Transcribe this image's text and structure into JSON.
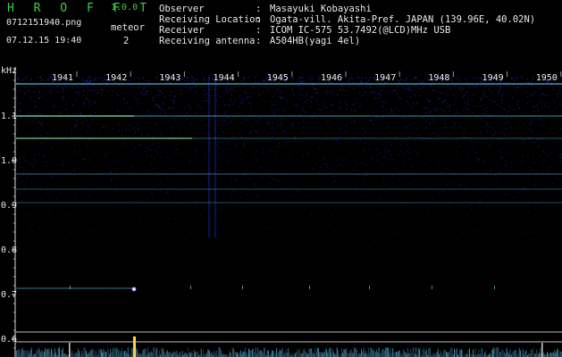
{
  "header": {
    "app_name": "H R O F F T",
    "app_version": "1.0.0",
    "file_name": "0712151940.png",
    "datetime": "07.12.15 19:40",
    "meteor_label": "meteor",
    "meteor_count": "2",
    "info": [
      {
        "label": "Observer",
        "value": "Masayuki Kobayashi"
      },
      {
        "label": "Receiving Location",
        "value": "Ogata-vill. Akita-Pref. JAPAN (139.96E, 40.02N)"
      },
      {
        "label": "Receiver",
        "value": "ICOM IC-575 53.7492(@LCD)MHz USB"
      },
      {
        "label": "Receiving antenna",
        "value": "A504HB(yagi 4el)"
      }
    ],
    "separator": ":"
  },
  "spectrogram": {
    "y_unit": "kHz",
    "y_ticks": [
      "1.1",
      "1.0",
      "0.9",
      "0.8",
      "0.7",
      "0.6"
    ],
    "minute_labels": [
      "1941",
      "1942",
      "1943",
      "1944",
      "1945",
      "1946",
      "1947",
      "1948",
      "1949",
      "1950"
    ],
    "colors": {
      "background": "#000000",
      "noise": "#1e2fd8",
      "line_green": "#9cf06a",
      "line_cyan": "#5fd4ff",
      "axis": "#d8d8d8",
      "marker": "#e8e8ff"
    }
  }
}
